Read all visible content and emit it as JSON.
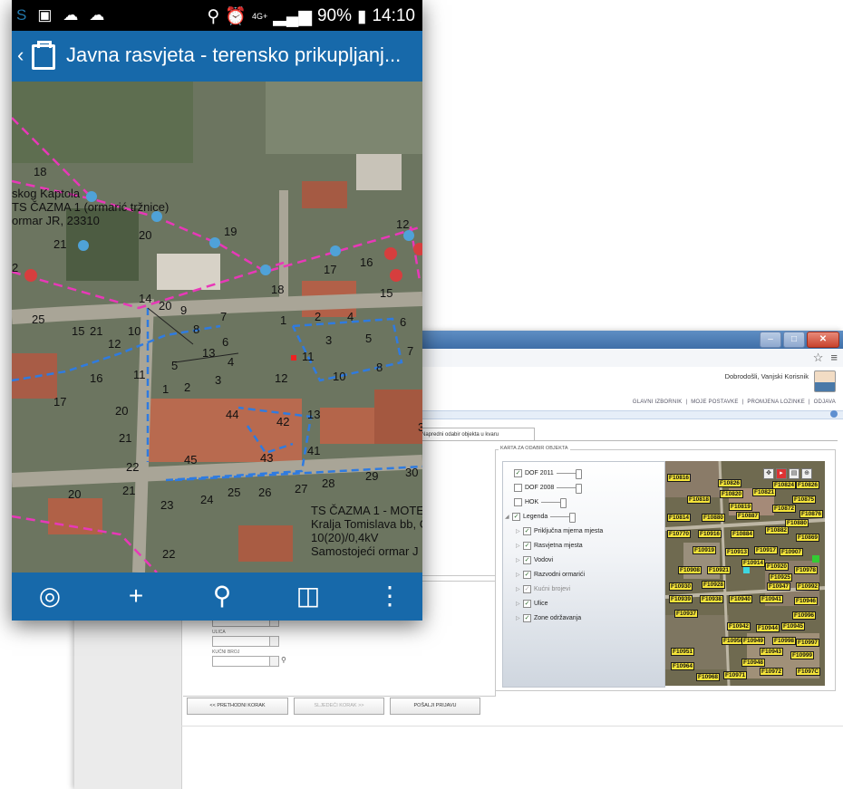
{
  "desktop": {
    "welcome": "Dobrodošli, Vanjski Korisnik",
    "nav": [
      "GLAVNI IZBORNIK",
      "MOJE POSTAVKE",
      "PROMJENA LOZINKE",
      "ODJAVA"
    ],
    "tab": "Napredni odabir objekta u kvaru",
    "fieldset_legend": "KARTA ZA ODABIR OBJEKTA",
    "layers": [
      {
        "label": "DOF 2011",
        "checked": true
      },
      {
        "label": "DOF 2008",
        "checked": false
      },
      {
        "label": "HOK",
        "checked": false
      },
      {
        "label": "Legenda",
        "checked": true
      },
      {
        "label": "Priključna mjerna mjesta",
        "checked": true
      },
      {
        "label": "Rasvjetna mjesta",
        "checked": true
      },
      {
        "label": "Vodovi",
        "checked": true
      },
      {
        "label": "Razvodni ormarići",
        "checked": true
      },
      {
        "label": "Kućni brojevi",
        "checked": true
      },
      {
        "label": "Ulice",
        "checked": true
      },
      {
        "label": "Zone održavanja",
        "checked": true
      }
    ],
    "fields": {
      "ulica": "ULICA",
      "kucni_broj": "KUĆNI BROJ"
    },
    "buttons": {
      "prev": "<< PRETHODNI KORAK",
      "next": "SLJEDEĆI KORAK >>",
      "send": "POŠALJI PRIJAVU"
    },
    "map_labels": [
      "F10816",
      "F10826",
      "F10824",
      "F10826",
      "F10818",
      "F10820",
      "F10821",
      "F10875",
      "F10819",
      "F10872",
      "F10876",
      "F10814",
      "F10880",
      "F10887",
      "F10880",
      "F10770",
      "F10916",
      "F10884",
      "F10882",
      "F10869",
      "F10919",
      "F10913",
      "F10917",
      "F10907",
      "F10914",
      "F10920",
      "F10978",
      "F10908",
      "F10921",
      "F10925",
      "F10930",
      "F10928",
      "F10947",
      "F10992",
      "F10939",
      "F10938",
      "F10940",
      "F10941",
      "F10946",
      "F10937",
      "F10996",
      "F10942",
      "F10944",
      "F10945",
      "F10950",
      "F10949",
      "F10998",
      "F10997",
      "F10951",
      "F10943",
      "F10999",
      "F10964",
      "F10948",
      "F10968",
      "F10971",
      "F10972",
      "F1097C"
    ]
  },
  "phone": {
    "status_time": "14:10",
    "status_battery": "90%",
    "status_network": "4G+",
    "title": "Javna rasvjeta - terensko prikupljanj...",
    "map_text": {
      "kaptol": "skog Kaptola",
      "ts1": "TS ČAZMA 1 (ormarić tržnice)",
      "ormar": "ormar JR, 23310",
      "ts2": "TS ČAZMA 1 - MOTE",
      "kralja": "Kralja Tomislava bb, Č",
      "kv": "10(20)/0,4kV",
      "samostojeci": "Samostojeći ormar J"
    },
    "house_numbers": [
      "18",
      "19",
      "20",
      "21",
      "12",
      "16",
      "17",
      "18",
      "15",
      "2",
      "25",
      "15",
      "21",
      "10",
      "12",
      "14",
      "20",
      "9",
      "7",
      "1",
      "2",
      "4",
      "6",
      "8",
      "13",
      "11",
      "5",
      "4",
      "6",
      "3",
      "5",
      "7",
      "16",
      "11",
      "12",
      "10",
      "8",
      "1",
      "2",
      "3",
      "44",
      "42",
      "13",
      "17",
      "20",
      "21",
      "43",
      "41",
      "22",
      "45",
      "29",
      "30",
      "28",
      "27",
      "26",
      "25",
      "24",
      "23",
      "20",
      "21",
      "22",
      "3"
    ]
  }
}
